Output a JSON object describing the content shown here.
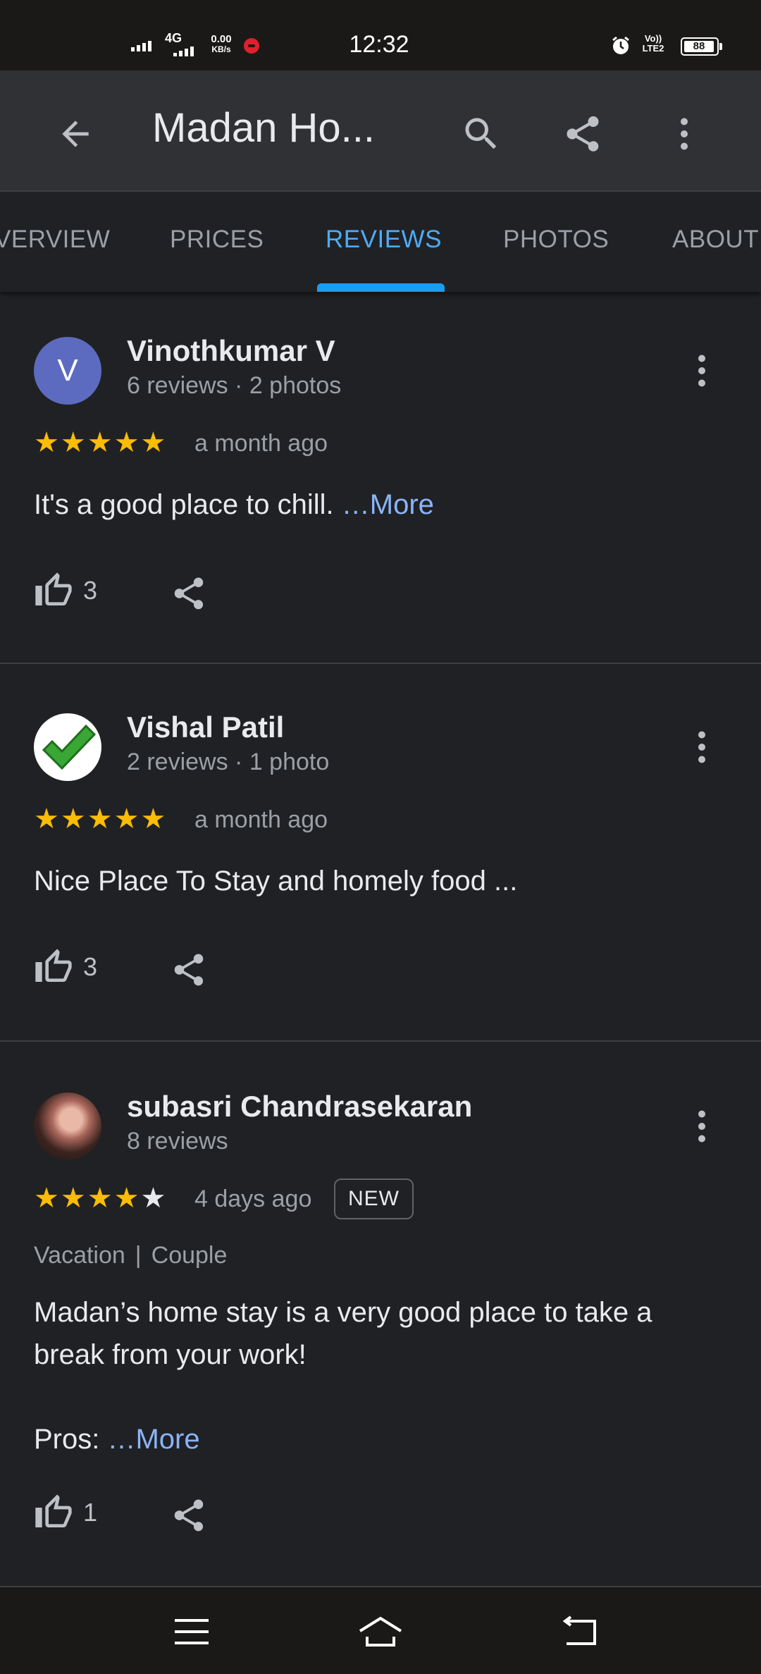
{
  "status_bar": {
    "network": "4G",
    "speed_value": "0.00",
    "speed_unit": "KB/s",
    "time": "12:32",
    "volte_line1": "Vo))",
    "volte_line2": "LTE2",
    "battery": "88"
  },
  "app_bar": {
    "back_icon": "arrow-left-icon",
    "title": "Madan Ho...",
    "search_icon": "search-icon",
    "share_icon": "share-icon",
    "more_icon": "more-vert-icon"
  },
  "tabs": [
    {
      "label": "VERVIEW",
      "active": false
    },
    {
      "label": "PRICES",
      "active": false
    },
    {
      "label": "REVIEWS",
      "active": true
    },
    {
      "label": "PHOTOS",
      "active": false
    },
    {
      "label": "ABOUT",
      "active": false
    }
  ],
  "colors": {
    "background": "#202124",
    "app_bar": "#303134",
    "accent": "#4dabf7",
    "star": "#fbbc04",
    "link": "#8ab4f8"
  },
  "reviews": [
    {
      "avatar_letter": "V",
      "author": "Vinothkumar V",
      "meta": "6 reviews · 2 photos",
      "rating": 5,
      "date": "a month ago",
      "text": "It's a good place to chill. ",
      "more_label": "…More",
      "likes": "3"
    },
    {
      "avatar_icon": "green-checkmark-icon",
      "author": "Vishal Patil",
      "meta": "2 reviews · 1 photo",
      "rating": 5,
      "date": "a month ago",
      "text": "Nice Place To Stay and homely food ...",
      "likes": "3"
    },
    {
      "avatar_icon": "profile-photo",
      "author": "subasri Chandrasekaran",
      "meta": "8 reviews",
      "rating": 4,
      "date": "4 days ago",
      "badge": "NEW",
      "trip_type": "Vacation",
      "trip_company": "Couple",
      "text_line1": "Madan’s home stay is a very good place to take a break from your work!",
      "text_line2": "Pros: ",
      "more_label": "…More",
      "likes": "1"
    }
  ],
  "nav_bar": {
    "menu_icon": "menu-icon",
    "home_icon": "home-icon",
    "back_icon": "back-icon"
  }
}
